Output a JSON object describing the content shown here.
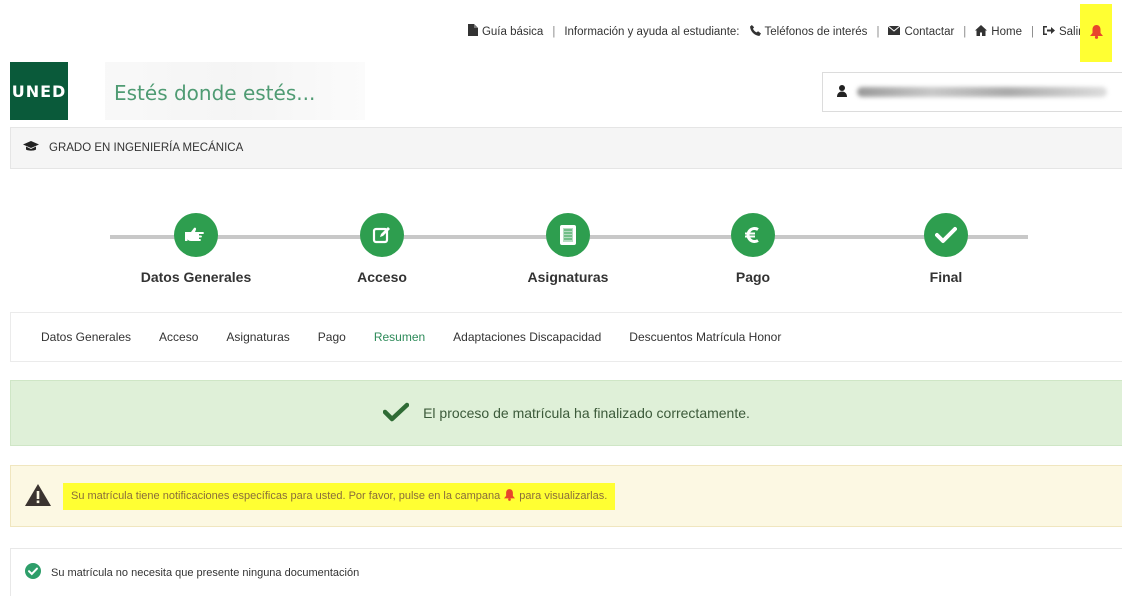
{
  "toplinks": {
    "guide": "Guía básica",
    "info": "Información y ayuda al estudiante:",
    "phones": "Teléfonos de interés",
    "contact": "Contactar",
    "home": "Home",
    "exit": "Salir",
    "separator": "|"
  },
  "header": {
    "logo_text": "UNED",
    "tagline": "Estés donde estés..."
  },
  "degree": {
    "title": "GRADO EN INGENIERÍA MECÁNICA"
  },
  "steps": [
    {
      "label": "Datos Generales",
      "icon": "hand-pointer-icon"
    },
    {
      "label": "Acceso",
      "icon": "edit-icon"
    },
    {
      "label": "Asignaturas",
      "icon": "book-icon"
    },
    {
      "label": "Pago",
      "icon": "euro-icon"
    },
    {
      "label": "Final",
      "icon": "check-icon"
    }
  ],
  "tabs": [
    {
      "label": "Datos Generales"
    },
    {
      "label": "Acceso"
    },
    {
      "label": "Asignaturas"
    },
    {
      "label": "Pago"
    },
    {
      "label": "Resumen",
      "active": true
    },
    {
      "label": "Adaptaciones Discapacidad"
    },
    {
      "label": "Descuentos Matrícula Honor"
    }
  ],
  "success": {
    "message": "El proceso de matrícula ha finalizado correctamente."
  },
  "warning": {
    "text_before": "Su matrícula tiene notificaciones específicas para usted. Por favor, pulse en la campana",
    "text_after": "para visualizarlas."
  },
  "documentation": {
    "message": "Su matrícula no necesita que presente ninguna documentación"
  },
  "colors": {
    "brand_green": "#2e9e4f",
    "logo_green": "#0a5a3a",
    "success_bg": "#dff0d8",
    "warning_bg": "#fcf8e3",
    "highlight": "#ffff33",
    "bell_red": "#e8452c"
  }
}
